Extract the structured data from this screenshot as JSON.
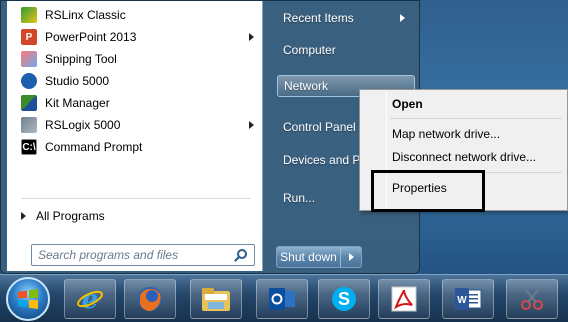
{
  "start_menu": {
    "programs": [
      {
        "label": "RSLinx Classic",
        "icon": "rslinx-icon",
        "glyph": "",
        "has_submenu": false
      },
      {
        "label": "PowerPoint 2013",
        "icon": "powerpoint-icon",
        "glyph": "P",
        "has_submenu": true
      },
      {
        "label": "Snipping Tool",
        "icon": "scissors-icon",
        "glyph": "",
        "has_submenu": false
      },
      {
        "label": "Studio 5000",
        "icon": "studio-5000-icon",
        "glyph": "",
        "has_submenu": false
      },
      {
        "label": "Kit Manager",
        "icon": "kit-manager-icon",
        "glyph": "",
        "has_submenu": false
      },
      {
        "label": "RSLogix 5000",
        "icon": "rslogix-icon",
        "glyph": "",
        "has_submenu": true
      },
      {
        "label": "Command Prompt",
        "icon": "command-prompt-icon",
        "glyph": "C:\\",
        "has_submenu": false
      }
    ],
    "all_programs": "All Programs",
    "search": {
      "placeholder": "Search programs and files",
      "value": ""
    },
    "right_items": [
      {
        "label": "Recent Items",
        "has_submenu": true
      },
      {
        "label": "Computer",
        "has_submenu": false
      },
      {
        "label": "Network",
        "has_submenu": false,
        "highlighted": true
      },
      {
        "label": "Control Panel",
        "has_submenu": false
      },
      {
        "label": "Devices and Pr",
        "has_submenu": false
      },
      {
        "label": "Run...",
        "has_submenu": false
      }
    ],
    "shutdown_label": "Shut down"
  },
  "context_menu": {
    "items": [
      {
        "label": "Open",
        "bold": true
      },
      {
        "label": "Map network drive...",
        "bold": false
      },
      {
        "label": "Disconnect network drive...",
        "bold": false
      },
      {
        "label": "Properties",
        "bold": false
      }
    ]
  },
  "taskbar": {
    "apps": [
      "internet-explorer-icon",
      "firefox-icon",
      "file-explorer-icon",
      "outlook-icon",
      "skype-icon",
      "acrobat-icon",
      "word-icon",
      "snipping-tool-icon"
    ]
  },
  "colors": {
    "menu_blue": "#3a607e",
    "taskbar": "#24476b",
    "highlight_box": "#000000"
  }
}
